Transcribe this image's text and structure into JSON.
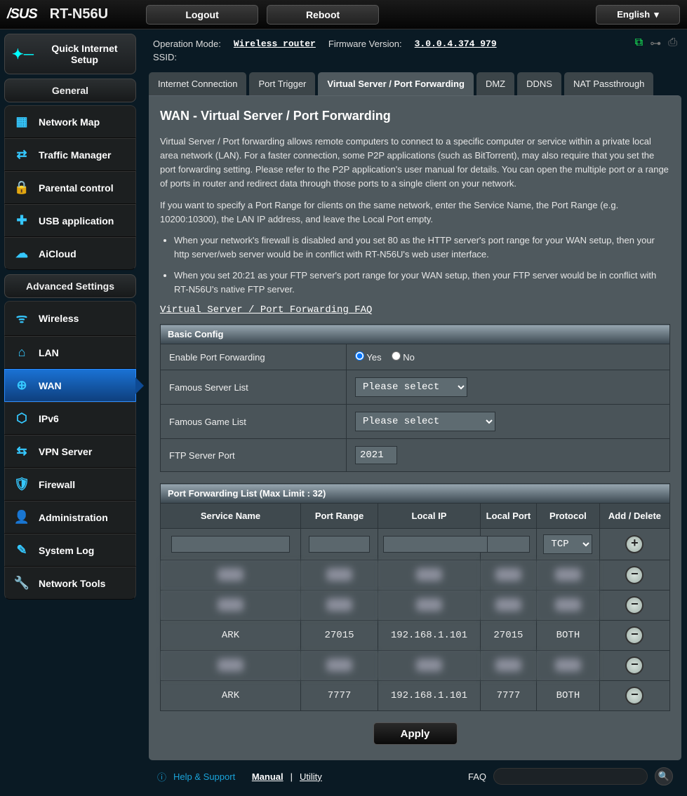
{
  "brand": "/SUS",
  "model": "RT-N56U",
  "topbar": {
    "logout": "Logout",
    "reboot": "Reboot",
    "language": "English"
  },
  "info": {
    "op_mode_label": "Operation Mode:",
    "op_mode_value": "Wireless router",
    "fw_label": "Firmware Version:",
    "fw_value": "3.0.0.4.374_979",
    "ssid_label": "SSID:",
    "ssid_value": ""
  },
  "sidebar": {
    "quick": "Quick Internet Setup",
    "general_title": "General",
    "general": [
      "Network Map",
      "Traffic Manager",
      "Parental control",
      "USB application",
      "AiCloud"
    ],
    "advanced_title": "Advanced Settings",
    "advanced": [
      "Wireless",
      "LAN",
      "WAN",
      "IPv6",
      "VPN Server",
      "Firewall",
      "Administration",
      "System Log",
      "Network Tools"
    ],
    "active": "WAN"
  },
  "tabs": {
    "items": [
      "Internet Connection",
      "Port Trigger",
      "Virtual Server / Port Forwarding",
      "DMZ",
      "DDNS",
      "NAT Passthrough"
    ],
    "active": 2
  },
  "page": {
    "title": "WAN - Virtual Server / Port Forwarding",
    "para1": "Virtual Server / Port forwarding allows remote computers to connect to a specific computer or service within a private local area network (LAN). For a faster connection, some P2P applications (such as BitTorrent), may also require that you set the port forwarding setting. Please refer to the P2P application's user manual for details. You can open the multiple port or a range of ports in router and redirect data through those ports to a single client on your network.",
    "para2": "If you want to specify a Port Range for clients on the same network, enter the Service Name, the Port Range (e.g. 10200:10300), the LAN IP address, and leave the Local Port empty.",
    "bullet1": "When your network's firewall is disabled and you set 80 as the HTTP server's port range for your WAN setup, then your http server/web server would be in conflict with RT-N56U's web user interface.",
    "bullet2": "When you set 20:21 as your FTP server's port range for your WAN setup, then your FTP server would be in conflict with RT-N56U's native FTP server.",
    "faq_link": "Virtual Server / Port Forwarding FAQ"
  },
  "basic": {
    "section": "Basic Config",
    "enable_label": "Enable Port Forwarding",
    "yes": "Yes",
    "no": "No",
    "enable_value": "Yes",
    "famous_server_label": "Famous Server List",
    "famous_server_value": "Please select",
    "famous_game_label": "Famous Game List",
    "famous_game_value": "Please select",
    "ftp_label": "FTP Server Port",
    "ftp_value": "2021"
  },
  "pf": {
    "section": "Port Forwarding List (Max Limit : 32)",
    "cols": [
      "Service Name",
      "Port Range",
      "Local IP",
      "Local Port",
      "Protocol",
      "Add / Delete"
    ],
    "protocol_default": "TCP",
    "rows": [
      {
        "blur": true,
        "service": "",
        "range": "",
        "ip": "",
        "local": "",
        "proto": ""
      },
      {
        "blur": true,
        "service": "",
        "range": "",
        "ip": "",
        "local": "",
        "proto": ""
      },
      {
        "blur": false,
        "service": "ARK",
        "range": "27015",
        "ip": "192.168.1.101",
        "local": "27015",
        "proto": "BOTH"
      },
      {
        "blur": true,
        "service": "",
        "range": "",
        "ip": "",
        "local": "",
        "proto": ""
      },
      {
        "blur": false,
        "service": "ARK",
        "range": "7777",
        "ip": "192.168.1.101",
        "local": "7777",
        "proto": "BOTH"
      }
    ],
    "apply": "Apply"
  },
  "footer": {
    "help": "Help & Support",
    "manual": "Manual",
    "utility": "Utility",
    "faq": "FAQ"
  }
}
